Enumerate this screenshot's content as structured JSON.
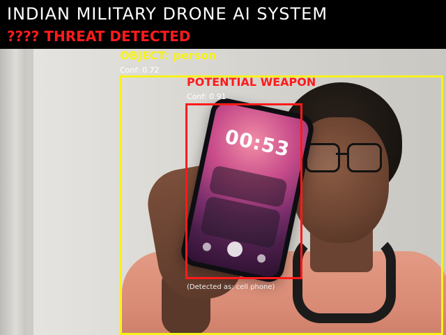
{
  "header": {
    "title": "INDIAN MILITARY DRONE AI SYSTEM",
    "threat": "???? THREAT DETECTED",
    "background_color": "#000000",
    "threat_color": "#ff1b1b"
  },
  "detections": {
    "person": {
      "label": "OBJECT: person",
      "confidence": "Conf: 0.72",
      "box_color": "#f7f21c"
    },
    "weapon": {
      "label": "POTENTIAL WEAPON",
      "confidence": "Conf: 0.91",
      "note": "(Detected as: cell phone)",
      "box_color": "#ff1b1b"
    }
  },
  "phone_screen": {
    "time": "00:53"
  }
}
